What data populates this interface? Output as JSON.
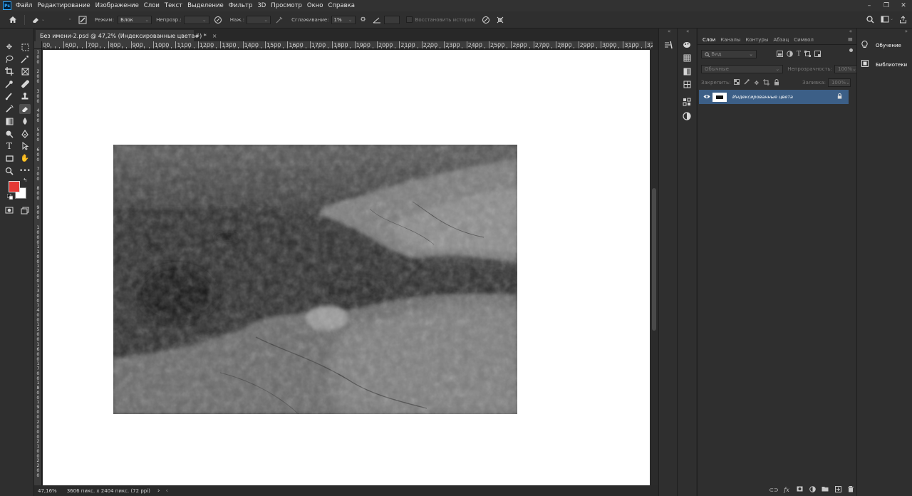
{
  "menu": {
    "logo": "Ps",
    "items": [
      "Файл",
      "Редактирование",
      "Изображение",
      "Слои",
      "Текст",
      "Выделение",
      "Фильтр",
      "3D",
      "Просмотр",
      "Окно",
      "Справка"
    ],
    "window_controls": [
      "–",
      "❐",
      "✕"
    ]
  },
  "options": {
    "mode_label": "Режим:",
    "mode_value": "Блок",
    "opacity_label": "Непрозр.:",
    "flow_label": "Наж.:",
    "smoothing_label": "Сглаживание:",
    "smoothing_value": "1%",
    "erase_history_label": "Восстановить историю"
  },
  "document": {
    "tab_title": "Без имени-2.psd @ 47,2% (Индексированные цвета#) *",
    "close": "×"
  },
  "ruler": {
    "top_labels": [
      "00",
      "600",
      "700",
      "800",
      "900",
      "1000",
      "1100",
      "1200",
      "1300",
      "1400",
      "1500",
      "1600",
      "1700",
      "1800",
      "1900",
      "2000",
      "2100",
      "2200",
      "2300",
      "2400",
      "2500",
      "2600",
      "2700",
      "2800",
      "2900",
      "3000",
      "3100",
      "32"
    ],
    "left_labels": [
      [
        "1",
        "0",
        "0"
      ],
      [
        "2",
        "0",
        "0"
      ],
      [
        "3",
        "0",
        "0"
      ],
      [
        "4",
        "0",
        "0"
      ],
      [
        "5",
        "0",
        "0"
      ],
      [
        "6",
        "0",
        "0"
      ],
      [
        "7",
        "0",
        "0"
      ],
      [
        "8",
        "0",
        "0"
      ],
      [
        "9",
        "0",
        "0"
      ],
      [
        "1",
        "0",
        "0",
        "0"
      ],
      [
        "1",
        "1",
        "0",
        "0"
      ],
      [
        "1",
        "2",
        "0",
        "0"
      ],
      [
        "1",
        "3",
        "0",
        "0"
      ],
      [
        "1",
        "4",
        "0",
        "0"
      ],
      [
        "1",
        "5",
        "0",
        "0"
      ],
      [
        "1",
        "6",
        "0",
        "0"
      ],
      [
        "1",
        "7",
        "0",
        "0"
      ],
      [
        "1",
        "8",
        "0",
        "0"
      ],
      [
        "1",
        "9",
        "0",
        "0"
      ],
      [
        "2",
        "0",
        "0",
        "0"
      ],
      [
        "2",
        "1",
        "0",
        "0"
      ],
      [
        "2",
        "2",
        "0",
        "0"
      ]
    ]
  },
  "status": {
    "zoom": "47,16%",
    "doc_info": "3606 пикс. x 2404 пикс. (72 ppi)",
    "arrow": "›",
    "left_arrow": "‹"
  },
  "layers_panel": {
    "tabs": [
      "Слои",
      "Каналы",
      "Контуры",
      "Абзац",
      "Символ"
    ],
    "active_tab": "Слои",
    "filter_placeholder": "Вид",
    "blend_mode": "Обычные",
    "opacity_label": "Непрозрачность:",
    "opacity_value": "100%",
    "lock_label": "Закрепить:",
    "fill_label": "Заливка:",
    "fill_value": "100%",
    "layer_name": "Индексированные цвета"
  },
  "learn_panel": {
    "learn": "Обучение",
    "libraries": "Библиотеки"
  },
  "colors": {
    "foreground": "#e53935",
    "background": "#ffffff",
    "selection": "#3c5f87"
  }
}
